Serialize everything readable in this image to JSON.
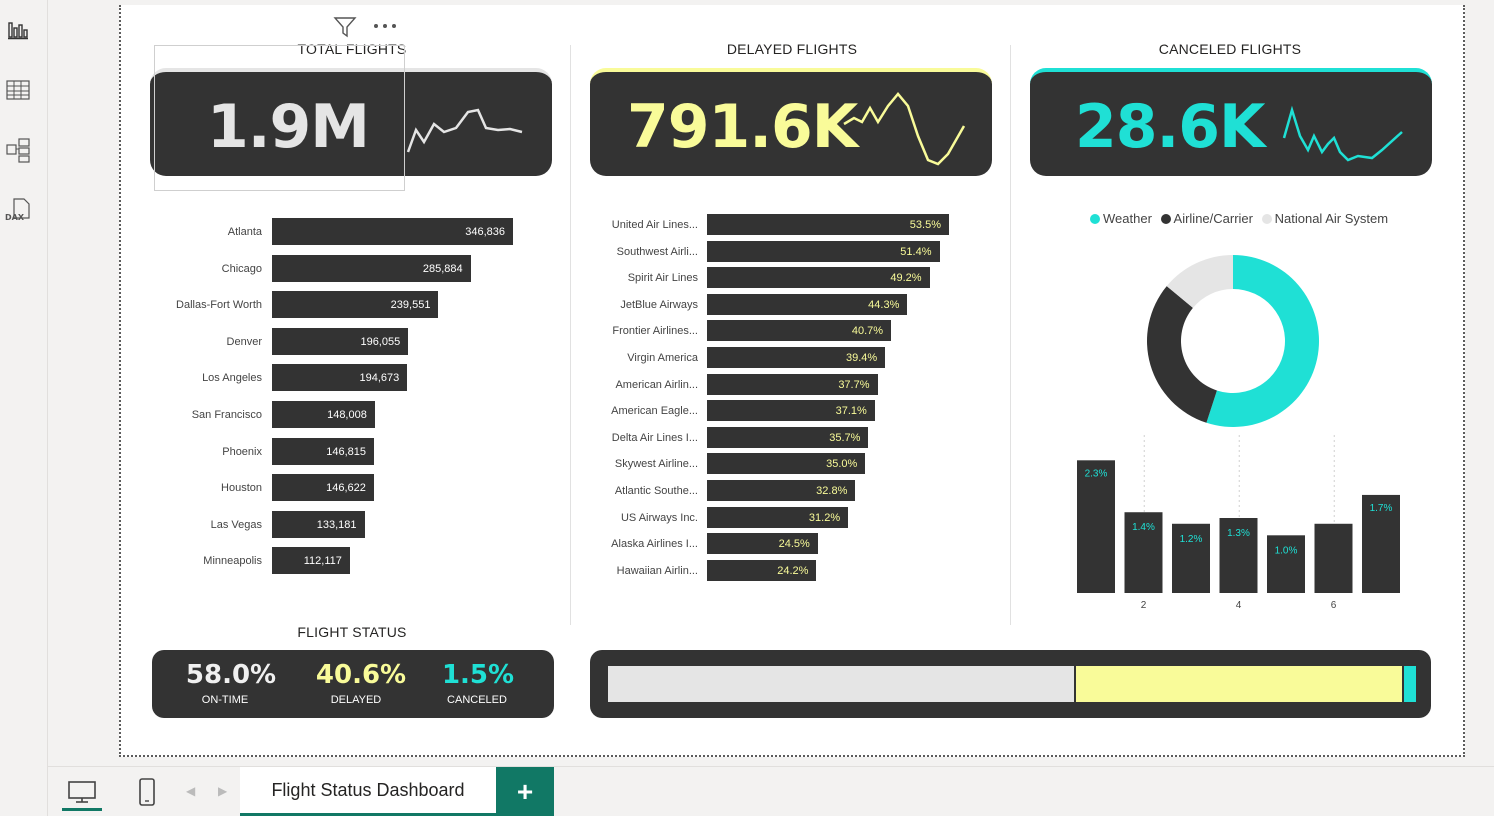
{
  "kpis": {
    "total": {
      "title": "TOTAL FLIGHTS",
      "value": "1.9M"
    },
    "delayed": {
      "title": "DELAYED FLIGHTS",
      "value": "791.6K"
    },
    "canceled": {
      "title": "CANCELED FLIGHTS",
      "value": "28.6K"
    }
  },
  "colors": {
    "card": "#333333",
    "yellow": "#f9fb99",
    "teal": "#1fe0d5",
    "lightgray": "#e5e5e5",
    "white": "#ffffff"
  },
  "chart_data": [
    {
      "type": "bar",
      "orientation": "horizontal",
      "categories": [
        "Atlanta",
        "Chicago",
        "Dallas-Fort Worth",
        "Denver",
        "Los Angeles",
        "San Francisco",
        "Phoenix",
        "Houston",
        "Las Vegas",
        "Minneapolis"
      ],
      "values": [
        346836,
        285884,
        239551,
        196055,
        194673,
        148008,
        146815,
        146622,
        133181,
        112117
      ],
      "labels": [
        "346,836",
        "285,884",
        "239,551",
        "196,055",
        "194,673",
        "148,008",
        "146,815",
        "146,622",
        "133,181",
        "112,117"
      ]
    },
    {
      "type": "bar",
      "orientation": "horizontal",
      "categories": [
        "United Air Lines...",
        "Southwest Airli...",
        "Spirit Air Lines",
        "JetBlue Airways",
        "Frontier Airlines...",
        "Virgin America",
        "American Airlin...",
        "American Eagle...",
        "Delta Air Lines I...",
        "Skywest Airline...",
        "Atlantic Southe...",
        "US Airways Inc.",
        "Alaska Airlines I...",
        "Hawaiian Airlin..."
      ],
      "values": [
        53.5,
        51.4,
        49.2,
        44.3,
        40.7,
        39.4,
        37.7,
        37.1,
        35.7,
        35.0,
        32.8,
        31.2,
        24.5,
        24.2
      ],
      "labels": [
        "53.5%",
        "51.4%",
        "49.2%",
        "44.3%",
        "40.7%",
        "39.4%",
        "37.7%",
        "37.1%",
        "35.7%",
        "35.0%",
        "32.8%",
        "31.2%",
        "24.5%",
        "24.2%"
      ]
    },
    {
      "type": "pie",
      "donut": true,
      "legend": [
        "Weather",
        "Airline/Carrier",
        "National Air System"
      ],
      "legend_position": "top",
      "values": [
        55,
        31,
        14
      ],
      "colors": [
        "#1fe0d5",
        "#333333",
        "#e5e5e5"
      ]
    },
    {
      "type": "bar",
      "x": [
        1,
        2,
        3,
        4,
        5,
        6,
        7
      ],
      "xticks": [
        "2",
        "4",
        "6"
      ],
      "values": [
        2.3,
        1.4,
        1.2,
        1.3,
        1.0,
        1.2,
        1.7
      ],
      "labels": [
        "2.3%",
        "1.4%",
        "1.2%",
        "1.3%",
        "1.0%",
        "",
        "1.7%"
      ],
      "ylim": [
        0,
        2.6
      ]
    }
  ],
  "flight_status": {
    "title": "FLIGHT STATUS",
    "items": [
      {
        "value": "58.0%",
        "label": "ON-TIME"
      },
      {
        "value": "40.6%",
        "label": "DELAYED"
      },
      {
        "value": "1.5%",
        "label": "CANCELED"
      }
    ],
    "shares": [
      58.0,
      40.6,
      1.5
    ]
  },
  "tabs": {
    "active": "Flight Status Dashboard",
    "add": "+"
  }
}
